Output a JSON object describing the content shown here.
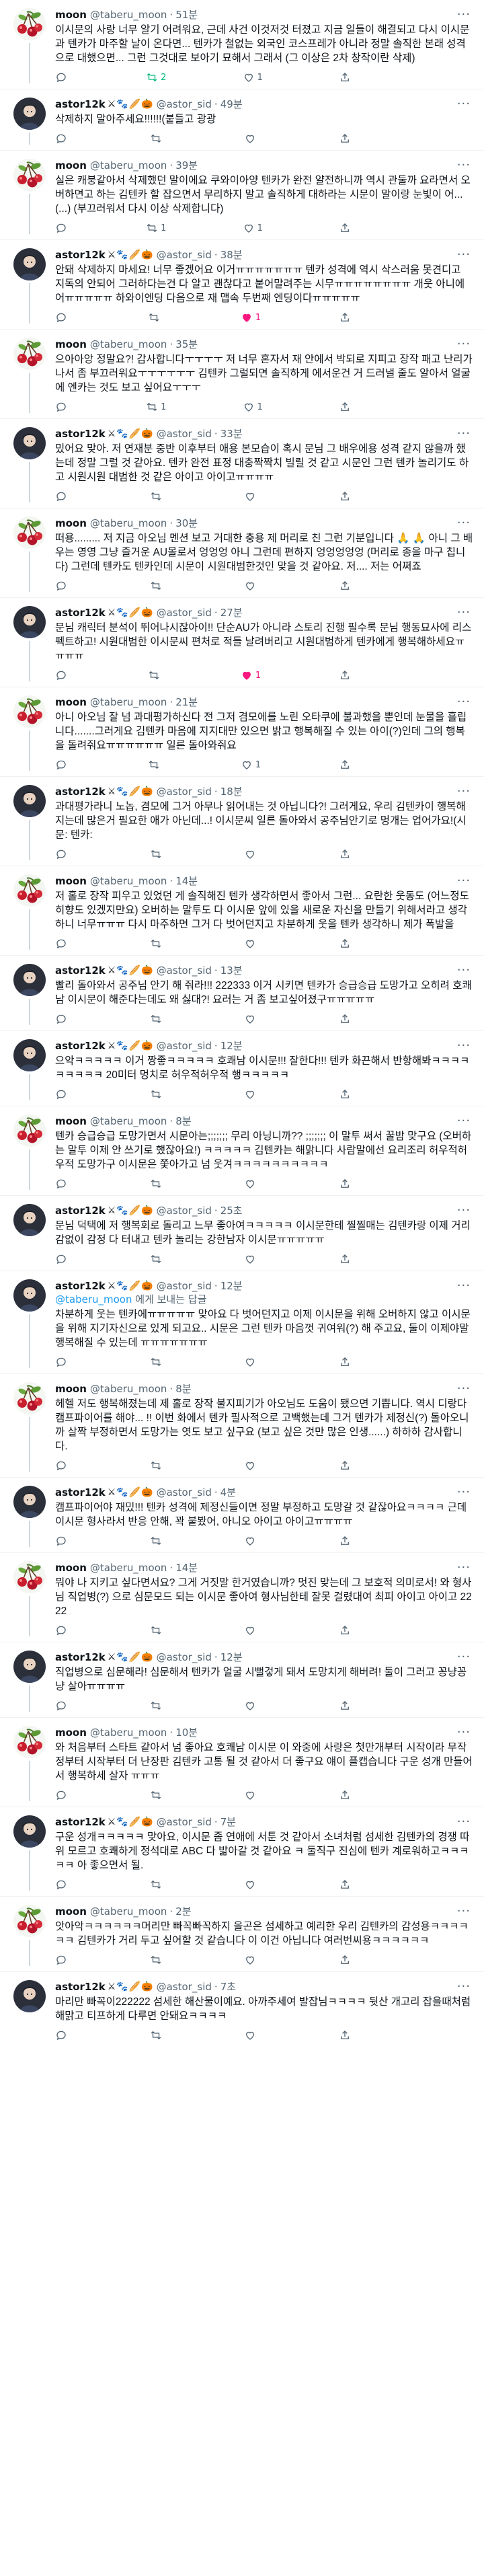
{
  "tweets": [
    {
      "author": "moon",
      "handle": "@taberu_moon",
      "time": "51분",
      "avatar": "cherry",
      "emojis": [],
      "text": "이시문의 사랑 너무 알기 어려워요, 근데 사건 이것저것 터졌고 지금 일들이 해결되고 다시 이시문과 텐카가 마주할 날이 온다면... 텐카가 철없는 외국인 코스프레가 아니라 정말 솔직한 본래 성격으로 대했으면... 그런 그것대로 보아기 묘해서 그래서 (그 이상은 2차 창작이란 삭제)",
      "reply": "",
      "rt": "2",
      "like": "1",
      "rt_on": true,
      "like_on": false
    },
    {
      "author": "astor12k",
      "handle": "@astor_sid",
      "time": "49분",
      "avatar": "dark",
      "emojis": [
        "⚔",
        "🐾",
        "🥖",
        "🎃"
      ],
      "text": "삭제하지 말아주세요!!!!!!(붙들고 광광",
      "reply": "",
      "rt": "",
      "like": "",
      "rt_on": false,
      "like_on": false
    },
    {
      "author": "moon",
      "handle": "@taberu_moon",
      "time": "39분",
      "avatar": "cherry",
      "emojis": [],
      "text": "실은 캐붕같아서 삭제했던 말이에요 쿠와이아양 텐카가 완전 얄전하니까 역시 관둘까 요라면서 오버하면고 하는 김텐카 할 잡으면서 무리하지 말고 솔직하게 대하라는 시문이 말이랑 눈빛이 어...(...) (부끄러워서 다시 이상 삭제합니다)",
      "reply": "",
      "rt": "1",
      "like": "1",
      "rt_on": false,
      "like_on": false
    },
    {
      "author": "astor12k",
      "handle": "@astor_sid",
      "time": "38분",
      "avatar": "dark",
      "emojis": [
        "⚔",
        "🐾",
        "🥖",
        "🎃"
      ],
      "text": "안돼 삭제하지 마세요! 너무 좋겠어요 이거ㅠㅠㅠㅠㅠㅠㅠ 텐카 성격에 역시 삭스러움 못견디고 지독의 안되어 그러하다는건 다 알고 괜찮다고 붙어말려주는 시무ㅠㅠㅠㅠㅠㅠㅠㅠ 개웃 아니에어ㅠㅠㅠㅠㅠ 하와이엔딩 다음으로 재 맵속 두번째 엔딩이다ㅠㅠㅠㅠㅠ",
      "reply": "",
      "rt": "",
      "like": "1",
      "rt_on": false,
      "like_on": true
    },
    {
      "author": "moon",
      "handle": "@taberu_moon",
      "time": "35분",
      "avatar": "cherry",
      "emojis": [],
      "text": "으아아앙 정말요?! 감사합니다ㅜㅜㅜㅜ 저 너무 혼자서 재 안에서 박되로 지피고 장작 패고 난리가 나서 좀 부끄러워요ㅜㅜㅜㅜㅜㅜ 김텐카 그럴되면 솔직하게 에서운건 거 드러낼 줄도 알아서 얼굴에 엔카는 것도 보고 싶어요ㅜㅜㅜ",
      "reply": "",
      "rt": "1",
      "like": "1",
      "rt_on": false,
      "like_on": false
    },
    {
      "author": "astor12k",
      "handle": "@astor_sid",
      "time": "33분",
      "avatar": "dark",
      "emojis": [
        "⚔",
        "🐾",
        "🥖",
        "🎃"
      ],
      "text": "밌어요 맞아. 저 연재분 중반 이후부터 애용 본모습이 혹시 문님 그 배우에용 성격 같지 않을까 했는데 정말 그럴 것 같아요. 텐카 완전 표정 대충짝짝치 빌릴 것 같고 시문인 그런 텐카 놀리기도 하고 시원시원 대범한 것 같은 아이고 아이고ㅠㅠㅠㅠ",
      "reply": "",
      "rt": "",
      "like": "",
      "rt_on": false,
      "like_on": false
    },
    {
      "author": "moon",
      "handle": "@taberu_moon",
      "time": "30분",
      "avatar": "cherry",
      "emojis": [],
      "text": "떠용......... 저 지금 아오님 멘션 보고 거대한 충용 제 머리로 친 그런 기분입니다 🙏 🙏 아니 그 배우는 영영 그냥 즐거운 AU몰로서 엉엉엉 아니 그런데 편하지 엉엉엉엉엉 (머리로 종을 마구 칩니다) 그런데 텐카도 텐카인데 시문이 시원대범한것인 맞을 것 같아요. 저.... 저는 어쩌죠",
      "reply": "",
      "rt": "",
      "like": "",
      "rt_on": false,
      "like_on": false
    },
    {
      "author": "astor12k",
      "handle": "@astor_sid",
      "time": "27분",
      "avatar": "dark",
      "emojis": [
        "⚔",
        "🐾",
        "🥖",
        "🎃"
      ],
      "text": "문님 캐릭터 분석이 뛰어나시잖아이!! 단순AU가 아니라 스토리 진행 필수록 문님 행동묘사에 리스펙트하고! 시원대범한 이시문씨 편처로 적들 날려버리고 시원대범하게 텐카에게 행복해하세요ㅠㅠㅠㅠ",
      "reply": "",
      "rt": "",
      "like": "1",
      "rt_on": false,
      "like_on": true
    },
    {
      "author": "moon",
      "handle": "@taberu_moon",
      "time": "21분",
      "avatar": "cherry",
      "emojis": [],
      "text": "아니 아오님 잘 넘 과대평가하신다 전 그저 겸모에를 노린 오타쿠에 불과했을 뿐인데 눈물을 흘립니다.......그러게요 김텐카 마음에 지지대만 있으면 밝고 행복해질 수 있는 아이(?)인데 그의 행복을 돌려줘요ㅠㅠㅠㅠㅠㅠ 일른 돌아와줘요",
      "reply": "",
      "rt": "",
      "like": "1",
      "rt_on": false,
      "like_on": false
    },
    {
      "author": "astor12k",
      "handle": "@astor_sid",
      "time": "18분",
      "avatar": "dark",
      "emojis": [
        "⚔",
        "🐾",
        "🥖",
        "🎃"
      ],
      "text": "과대평가라니 노놉, 겸모에 그거 아무나 읽어내는 것 아닙니다?! 그러게요, 우리 김텐카이 행복해지는데 많은거 필요한 애가 아닌데...! 이시문씨 일른 돌아와서 공주님안기로 멍개는 업어가요!(시문: 텐카:",
      "reply": "",
      "rt": "",
      "like": "",
      "rt_on": false,
      "like_on": false
    },
    {
      "author": "moon",
      "handle": "@taberu_moon",
      "time": "14분",
      "avatar": "cherry",
      "emojis": [],
      "text": "저 홀로 장작 피우고 있었던 게 솔직해진 텐카 생각하면서 좋아서 그런... 요란한 웃동도 (어느정도 히향도 있겠지만요) 오버하는 말투도 다 이시문 앞에 있을 새로운 자신을 만들기 위해서라고 생각하니 너무ㅠㅠㅠ 다시 마주하면 그거 다 벗어던지고 차분하게 웃을 텐카 생각하니 제가 폭발을",
      "reply": "",
      "rt": "",
      "like": "",
      "rt_on": false,
      "like_on": false
    },
    {
      "author": "astor12k",
      "handle": "@astor_sid",
      "time": "13분",
      "avatar": "dark",
      "emojis": [
        "⚔",
        "🐾",
        "🥖",
        "🎃"
      ],
      "text": "빨리 돌아와서 공주님 안기 해 줘라!!! 222333 이거 시키면 텐카가 승급승급 도망가고 오히려 호쾌남 이시문이 해준다는데도 왜 싫대?! 요러는 거 좀 보고싶어졌구ㅠㅠㅠㅠㅠ",
      "reply": "",
      "rt": "",
      "like": "",
      "rt_on": false,
      "like_on": false
    },
    {
      "author": "astor12k",
      "handle": "@astor_sid",
      "time": "12분",
      "avatar": "dark",
      "emojis": [
        "⚔",
        "🐾",
        "🥖",
        "🎃"
      ],
      "text": "으악ㅋㅋㅋㅋㅋ 이거 짱좋ㅋㅋㅋㅋㅋ 호쾌남 이시문!!! 잘한다!!! 텐카 화끈해서 반항해봐ㅋㅋㅋㅋㅋㅋㅋㅋㅋ 20미터 멍치로 허우적허우적 행ㅋㅋㅋㅋㅋ",
      "reply": "",
      "rt": "",
      "like": "",
      "rt_on": false,
      "like_on": false
    },
    {
      "author": "moon",
      "handle": "@taberu_moon",
      "time": "8분",
      "avatar": "cherry",
      "emojis": [],
      "text": "텐카 승급승급 도망가면서 시문아는;;;;;;; 무리 아닝니까?? ;;;;;;; 이 말투 써서 꿀밤 맞구요 (오버하는 말투 이제 안 쓰기로 했잖아요!) ㅋㅋㅋㅋㅋ 김텐카는 해맑니다 사람말에선 요리조리 허우적허우적 도망가구 이시문은 쫓아가고 넘 웃겨ㅋㅋㅋㅋㅋㅋㅋㅋㅋㅋ",
      "reply": "",
      "rt": "",
      "like": "",
      "rt_on": false,
      "like_on": false
    },
    {
      "author": "astor12k",
      "handle": "@astor_sid",
      "time": "25초",
      "avatar": "dark",
      "emojis": [
        "⚔",
        "🐾",
        "🥖",
        "🎃"
      ],
      "text": "문님 덕택에 저 행복회로 돌리고 느무 좋아여ㅋㅋㅋㅋㅋ 이시문한테 찔찔매는 김텐카랑 이제 거리감없이 감정 다 터내고 텐카 놀리는 강한남자 이시문ㅠㅠㅠㅠㅠ",
      "reply": "",
      "rt": "",
      "like": "",
      "rt_on": false,
      "like_on": false
    },
    {
      "author": "astor12k",
      "handle": "@astor_sid",
      "time": "12분",
      "avatar": "dark",
      "emojis": [
        "⚔",
        "🐾",
        "🥖",
        "🎃"
      ],
      "text": "차분하게 웃는 텐카에ㅠㅠㅠㅠㅠ 맞아요 다 벗어던지고 이제 이시문을 위해 오버하지 않고 이시문을 위해 지기자신으로 있게 되고요.. 시문은 그런 텐카 마음껏 귀여워(?) 해 주고요, 둘이 이제야말 행복해질 수 있는데 ㅠㅠㅠㅠㅠㅠㅠ",
      "reply": "@taberu_moon",
      "rt": "",
      "like": "",
      "rt_on": false,
      "like_on": false
    },
    {
      "author": "moon",
      "handle": "@taberu_moon",
      "time": "8분",
      "avatar": "cherry",
      "emojis": [],
      "text": "헤헬 저도 행복해졌는데 제 홀로 장작 불지피기가 아오님도 도움이 됐으면 기쁩니다. 역시 디랑다 캠프파이어를 해야... !! 이번 화에서 텐카 필사적으로 고백했는데 그거 텐카가 제정신(?) 돌아오니까 살짝 부정하면서 도망가는 엿도 보고 싶구요 (보고 싶은 것만 많은 인생......) 하하하 감사합니다.",
      "reply": "",
      "rt": "",
      "like": "",
      "rt_on": false,
      "like_on": false
    },
    {
      "author": "astor12k",
      "handle": "@astor_sid",
      "time": "4분",
      "avatar": "dark",
      "emojis": [
        "⚔",
        "🐾",
        "🥖",
        "🎃"
      ],
      "text": "캠프파이어야 재밌!!! 텐카 성격에 제정신들이면 정말 부정하고 도망갈 것 같잖아요ㅋㅋㅋㅋ 근데 이시문 형사라서 반응 안해, 꽉 붙봤어, 아니오 아이고 아이고ㅠㅠㅠㅠ",
      "reply": "",
      "rt": "",
      "like": "",
      "rt_on": false,
      "like_on": false
    },
    {
      "author": "moon",
      "handle": "@taberu_moon",
      "time": "14분",
      "avatar": "cherry",
      "emojis": [],
      "text": "뭐야 나 지키고 싶다면서요? 그게 거짓말 한거였습니까? 멋진 맞는데 그 보호적 의미로서! 와 형사님 직업병(?) 으로 심문모드 되는 이시문 좋아여 형사님한테 잘못 걸렸대여 최피 아이고 아이고 2222",
      "reply": "",
      "rt": "",
      "like": "",
      "rt_on": false,
      "like_on": false
    },
    {
      "author": "astor12k",
      "handle": "@astor_sid",
      "time": "12분",
      "avatar": "dark",
      "emojis": [
        "⚔",
        "🐾",
        "🥖",
        "🎃"
      ],
      "text": "직업병으로 심문해라! 심문해서 텐카가 얼굴 시뻘겋게 돼서 도망치게 해버려! 둘이 그러고 꽁냥꽁냥 살아ㅠㅠㅠㅠ",
      "reply": "",
      "rt": "",
      "like": "",
      "rt_on": false,
      "like_on": false
    },
    {
      "author": "moon",
      "handle": "@taberu_moon",
      "time": "10분",
      "avatar": "cherry",
      "emojis": [],
      "text": "와 처음부터 스타트 같아서 넘 좋아요 호쾌남 이시문 이 와중에 사랑은 첫만개부터 시작이라 무작정부터 시작부터 더 난장판 김텐카 고통 될 것 같아서 더 좋구요 얘이 플캡습니다 구운 성개 만들어서 행복하세 살자 ㅠㅠㅠ",
      "reply": "",
      "rt": "",
      "like": "",
      "rt_on": false,
      "like_on": false
    },
    {
      "author": "astor12k",
      "handle": "@astor_sid",
      "time": "7분",
      "avatar": "dark",
      "emojis": [
        "⚔",
        "🐾",
        "🥖",
        "🎃"
      ],
      "text": "구운 성개ㅋㅋㅋㅋㅋ 맞아요, 이시문 좀 연애에 서툰 것 같아서 소녀처럼 섬세한 김텐카의 경쟁 따위 모르고 호쾌하게 정석대로 ABC 다 밟아갈 것 같아요 ㅋ 둘직구 진심에 텐카 계로워하고ㅋㅋㅋㅋㅋ 아 좋으면서 될.",
      "reply": "",
      "rt": "",
      "like": "",
      "rt_on": false,
      "like_on": false
    },
    {
      "author": "moon",
      "handle": "@taberu_moon",
      "time": "2분",
      "avatar": "cherry",
      "emojis": [],
      "text": "앗아악ㅋㅋㅋㅋㅋㅋ머리만 빠꼭빠꼭하지 을곤은 섬세하고 예리한 우리 김텐카의 감성용ㅋㅋㅋㅋㅋㅋ 김텐카가 거리 두고 싶어할 것 같습니다 이 이건 아닙니다 여러번씨용ㅋㅋㅋㅋㅋㅋ",
      "reply": "",
      "rt": "",
      "like": "",
      "rt_on": false,
      "like_on": false
    },
    {
      "author": "astor12k",
      "handle": "@astor_sid",
      "time": "7초",
      "avatar": "dark",
      "emojis": [
        "⚔",
        "🐾",
        "🥖",
        "🎃"
      ],
      "text": "마리만 빠꼭이222222 섬세한 해산물이예요. 아까주세여 발잡님ㅋㅋㅋㅋ 뒷산 개고리 잡을때처럼 해맑고 티프하게 다루면 안돼요ㅋㅋㅋㅋ",
      "reply": "",
      "rt": "",
      "like": "",
      "rt_on": false,
      "like_on": false
    }
  ],
  "labels": {
    "replying_prefix": "에게 보내는 답글"
  },
  "colors": {
    "link": "#1d9bf0",
    "retweet": "#00ba7c",
    "like": "#f91880",
    "muted": "#536471"
  }
}
